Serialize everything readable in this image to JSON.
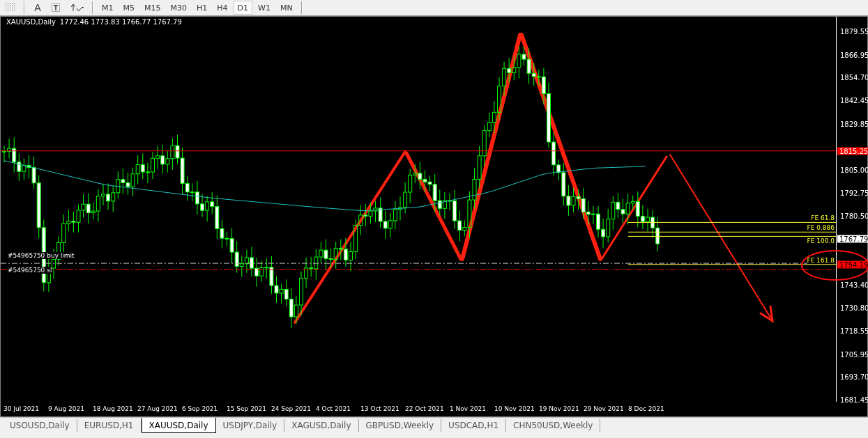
{
  "toolbar": {
    "text_tool": "A",
    "timeframes": [
      {
        "label": "M1",
        "selected": false
      },
      {
        "label": "M5",
        "selected": false
      },
      {
        "label": "M15",
        "selected": false
      },
      {
        "label": "M30",
        "selected": false
      },
      {
        "label": "H1",
        "selected": false
      },
      {
        "label": "H4",
        "selected": false
      },
      {
        "label": "D1",
        "selected": true
      },
      {
        "label": "W1",
        "selected": false
      },
      {
        "label": "MN",
        "selected": false
      }
    ]
  },
  "chart": {
    "symbol": "XAUUSD,Daily",
    "ohlc": "1772.46 1773.83 1766.77 1767.79",
    "price_axis": [
      "1879.55",
      "1866.95",
      "1854.70",
      "1842.45",
      "1829.85",
      "1805.00",
      "1792.75",
      "1780.50",
      "1743.40",
      "1730.80",
      "1718.55",
      "1705.95",
      "1693.70",
      "1681.45"
    ],
    "price_tags": [
      {
        "label": "1815.25",
        "kind": "line"
      },
      {
        "label": "1767.79",
        "kind": "bid"
      },
      {
        "label": "1754.19",
        "kind": "order"
      }
    ],
    "levels": [
      {
        "label": "FE 61.8"
      },
      {
        "label": "FE 0.886"
      },
      {
        "label": "FE 100.0"
      },
      {
        "label": "FE 161.8"
      }
    ],
    "orders": [
      {
        "label": "#54965750 buy limit"
      },
      {
        "label": "#54965750 sl"
      }
    ],
    "dates": [
      "30 Jul 2021",
      "9 Aug 2021",
      "18 Aug 2021",
      "27 Aug 2021",
      "6 Sep 2021",
      "15 Sep 2021",
      "24 Sep 2021",
      "4 Oct 2021",
      "13 Oct 2021",
      "22 Oct 2021",
      "1 Nov 2021",
      "10 Nov 2021",
      "19 Nov 2021",
      "29 Nov 2021",
      "8 Dec 2021"
    ]
  },
  "tabs": [
    {
      "label": "USOUSD,Daily",
      "selected": false
    },
    {
      "label": "EURUSD,H1",
      "selected": false
    },
    {
      "label": "XAUUSD,Daily",
      "selected": true
    },
    {
      "label": "USDJPY,Daily",
      "selected": false
    },
    {
      "label": "XAGUSD,Daily",
      "selected": false
    },
    {
      "label": "GBPUSD,Weekly",
      "selected": false
    },
    {
      "label": "USDCAD,H1",
      "selected": false
    },
    {
      "label": "CHN50USD,Weekly",
      "selected": false
    }
  ]
}
